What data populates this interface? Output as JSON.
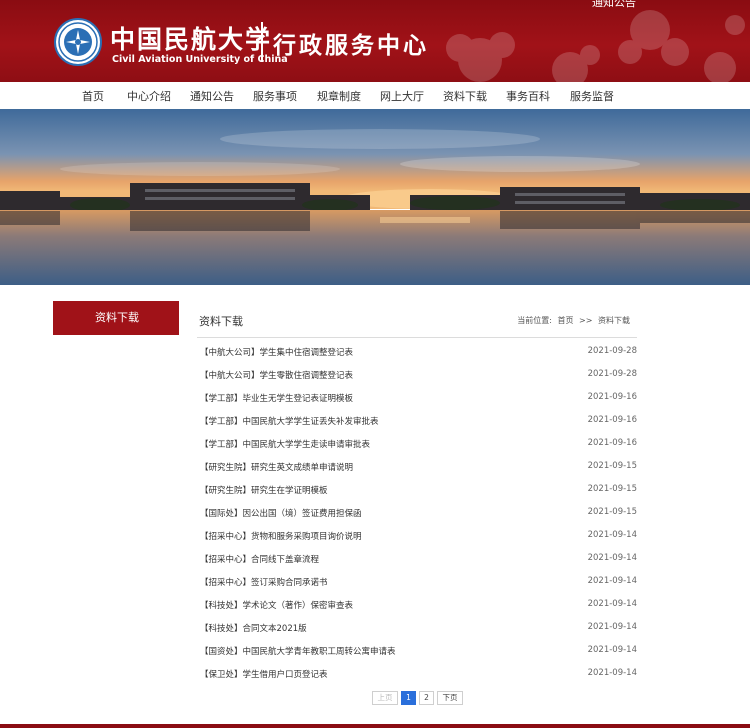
{
  "header": {
    "top_link": "通知公告",
    "school_name_cn": "中国民航大学",
    "school_name_en": "Civil Aviation University of China",
    "subtitle": "行政服务中心",
    "logo_icon": "university-emblem-icon"
  },
  "colors": {
    "brand_red": "#a01218",
    "active_page": "#2a6fdb"
  },
  "nav": {
    "items": [
      {
        "label": "首页"
      },
      {
        "label": "中心介绍"
      },
      {
        "label": "通知公告"
      },
      {
        "label": "服务事项"
      },
      {
        "label": "规章制度"
      },
      {
        "label": "网上大厅"
      },
      {
        "label": "资料下载"
      },
      {
        "label": "事务百科"
      },
      {
        "label": "服务监督"
      }
    ]
  },
  "sidebar": {
    "active_label": "资料下载"
  },
  "main": {
    "section_title": "资料下载",
    "breadcrumb": {
      "prefix": "当前位置:",
      "home": "首页",
      "sep": ">>",
      "current": "资料下载"
    },
    "items": [
      {
        "title": "【中航大公司】学生集中住宿调整登记表",
        "date": "2021-09-28"
      },
      {
        "title": "【中航大公司】学生零散住宿调整登记表",
        "date": "2021-09-28"
      },
      {
        "title": "【学工部】毕业生无学生登记表证明模板",
        "date": "2021-09-16"
      },
      {
        "title": "【学工部】中国民航大学学生证丢失补发审批表",
        "date": "2021-09-16"
      },
      {
        "title": "【学工部】中国民航大学学生走读申请审批表",
        "date": "2021-09-16"
      },
      {
        "title": "【研究生院】研究生英文成绩单申请说明",
        "date": "2021-09-15"
      },
      {
        "title": "【研究生院】研究生在学证明模板",
        "date": "2021-09-15"
      },
      {
        "title": "【国际处】因公出国（境）签证费用担保函",
        "date": "2021-09-15"
      },
      {
        "title": "【招采中心】货物和服务采购项目询价说明",
        "date": "2021-09-14"
      },
      {
        "title": "【招采中心】合同线下盖章流程",
        "date": "2021-09-14"
      },
      {
        "title": "【招采中心】签订采购合同承诺书",
        "date": "2021-09-14"
      },
      {
        "title": "【科技处】学术论文（著作）保密审查表",
        "date": "2021-09-14"
      },
      {
        "title": "【科技处】合同文本2021版",
        "date": "2021-09-14"
      },
      {
        "title": "【国资处】中国民航大学青年教职工周转公寓申请表",
        "date": "2021-09-14"
      },
      {
        "title": "【保卫处】学生借用户口页登记表",
        "date": "2021-09-14"
      }
    ]
  },
  "pagination": {
    "prev": "上页",
    "pages": [
      "1",
      "2"
    ],
    "current": "1",
    "next": "下页"
  }
}
